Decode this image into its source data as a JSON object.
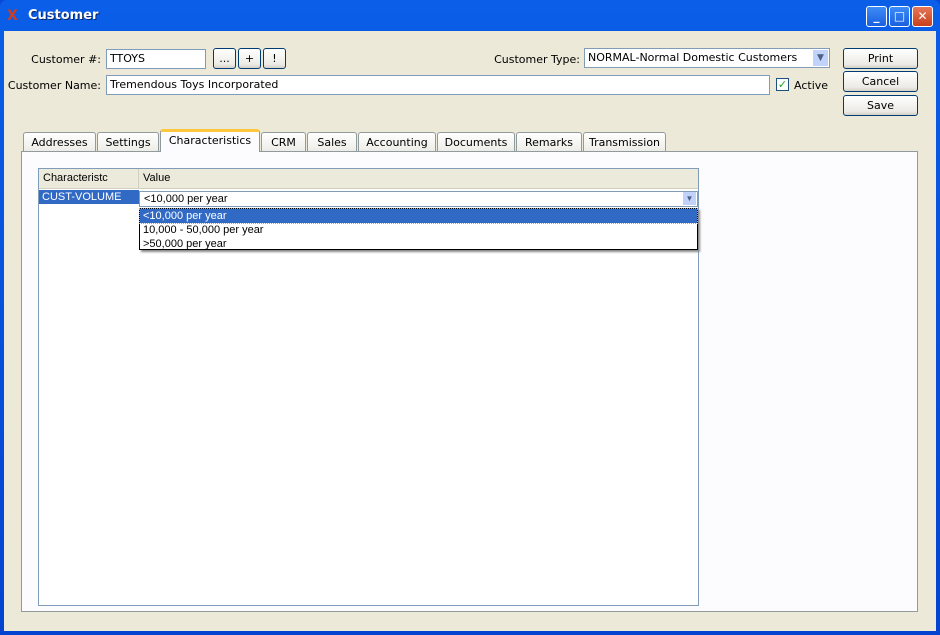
{
  "window": {
    "title": "Customer",
    "minimize": "_",
    "maximize": "□",
    "close": "✕"
  },
  "form": {
    "customer_number_label": "Customer #:",
    "customer_number": "TTOYS",
    "lookup_button": "...",
    "new_button": "+",
    "alert_button": "!",
    "customer_name_label": "Customer Name:",
    "customer_name": "Tremendous Toys Incorporated",
    "customer_type_label": "Customer Type:",
    "customer_type": "NORMAL-Normal Domestic Customers",
    "active_label": "Active",
    "active": true
  },
  "actions": {
    "print": "Print",
    "cancel": "Cancel",
    "save": "Save"
  },
  "tabs": [
    "Addresses",
    "Settings",
    "Characteristics",
    "CRM",
    "Sales",
    "Accounting",
    "Documents",
    "Remarks",
    "Transmission"
  ],
  "active_tab": "Characteristics",
  "table": {
    "headers": [
      "Characteristc",
      "Value"
    ],
    "rows": [
      {
        "characteristic": "CUST-VOLUME",
        "value": "<10,000 per year"
      }
    ],
    "dropdown_options": [
      "<10,000 per year",
      "10,000 - 50,000 per year",
      ">50,000 per year"
    ]
  }
}
